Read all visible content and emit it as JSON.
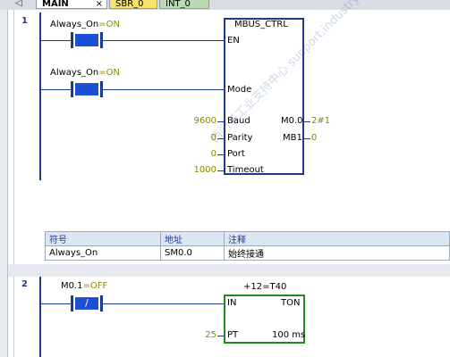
{
  "tabs": [
    {
      "label": "MAIN",
      "close": "×"
    },
    {
      "label": "SBR_0"
    },
    {
      "label": "INT_0"
    }
  ],
  "network1": {
    "number": "1",
    "contact1": {
      "address": "Always_On",
      "state": "=ON"
    },
    "contact2": {
      "address": "Always_On",
      "state": "=ON"
    },
    "block": {
      "title": "MBUS_CTRL",
      "inputs": [
        "EN",
        "Mode",
        "Baud",
        "Parity",
        "Port",
        "Timeout"
      ],
      "input_values": {
        "baud": "9600",
        "parity": "0",
        "port": "0",
        "timeout": "1000"
      },
      "outputs": [
        {
          "pin": "M0.0",
          "value": "2#1"
        },
        {
          "pin": "MB1",
          "value": "0"
        }
      ]
    },
    "symbol_table": {
      "headers": [
        "符号",
        "地址",
        "注释"
      ],
      "rows": [
        [
          "Always_On",
          "SM0.0",
          "始终接通"
        ]
      ]
    }
  },
  "network2": {
    "number": "2",
    "contact": {
      "address": "M0.1",
      "state": "=OFF",
      "symbol": "/"
    },
    "timer": {
      "header": "+12=T40",
      "in_pin": "IN",
      "type": "TON",
      "pt_pin": "PT",
      "pt_value": "25",
      "resolution": "100 ms"
    }
  },
  "watermark": "西门子工业支持中心 support.industry.siemens.com"
}
